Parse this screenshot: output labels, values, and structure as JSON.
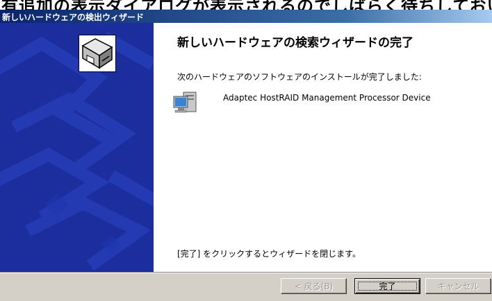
{
  "background_text": "有追加の表示ダイアログが表示されるのでしばらく待ちしておいてください",
  "window": {
    "title": "新しいハードウェアの検出ウィザード"
  },
  "content": {
    "heading": "新しいハードウェアの検索ウィザードの完了",
    "message": "次のハードウェアのソフトウェアのインストールが完了しました:",
    "device_name": "Adaptec HostRAID Management Processor Device",
    "footer_text": "[完了] をクリックするとウィザードを閉じます。"
  },
  "buttons": {
    "back": "< 戻る(B)",
    "finish": "完了",
    "cancel": "キャンセル"
  },
  "icons": {
    "side": "hardware-wizard-icon",
    "device": "computer-device-icon"
  },
  "colors": {
    "title_bar": "#0a246a",
    "side_panel": "#1c2e9e",
    "button_face": "#d4d0c8"
  }
}
